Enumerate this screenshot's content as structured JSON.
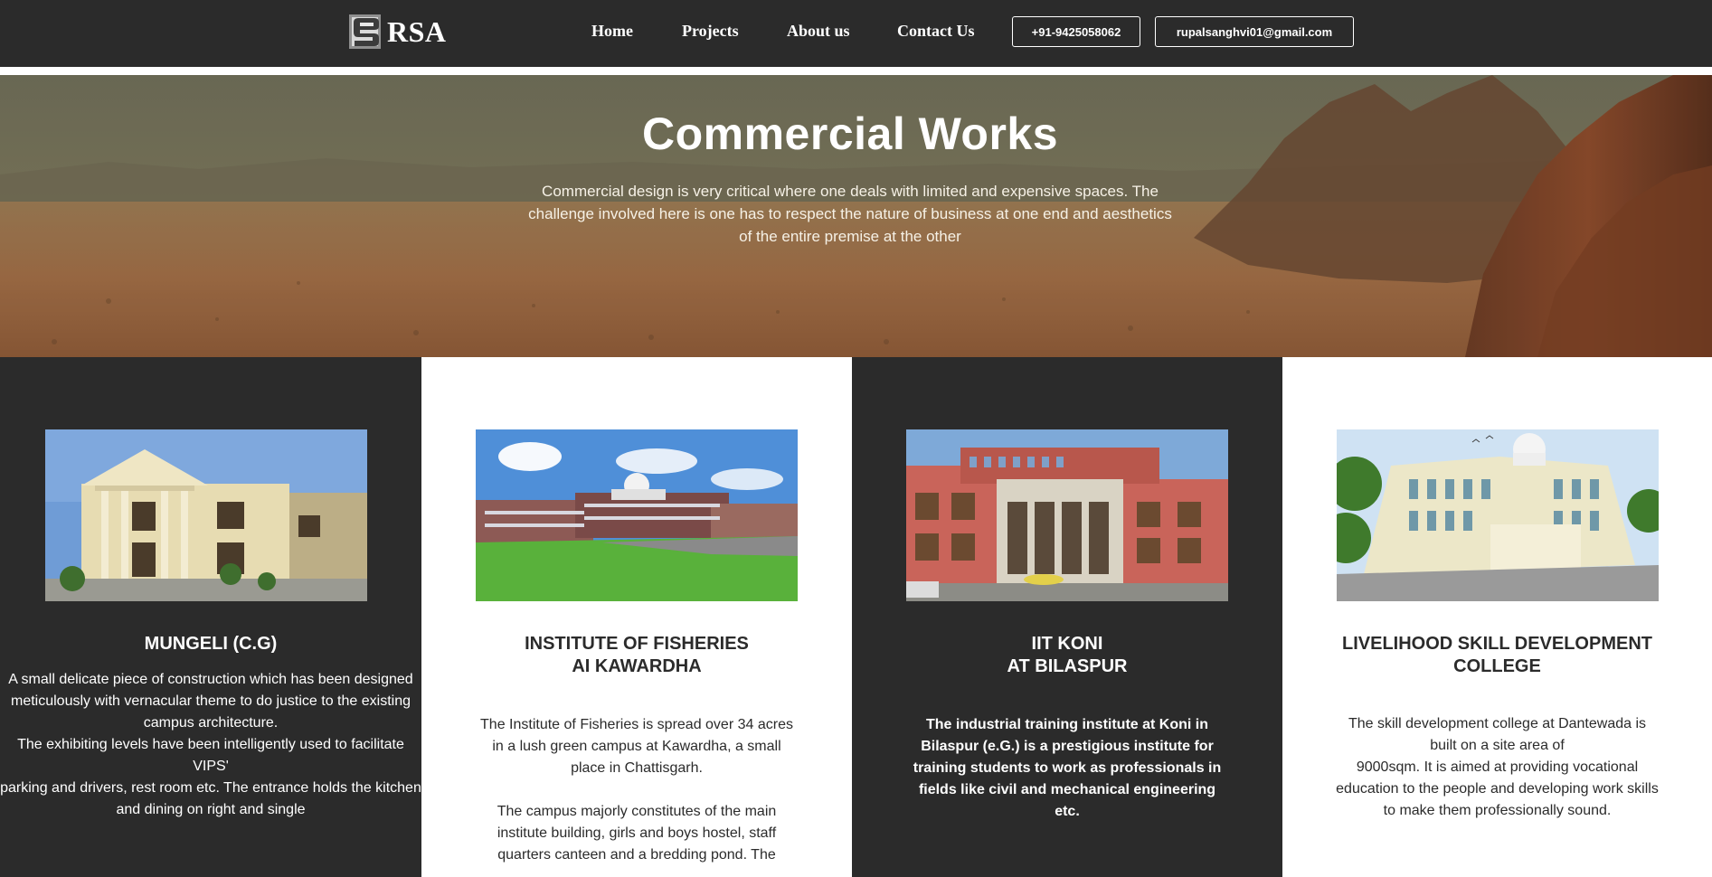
{
  "header": {
    "brand": "RSA",
    "nav": [
      "Home",
      "Projects",
      "About us",
      "Contact Us"
    ],
    "phone": "+91-9425058062",
    "email": "rupalsanghvi01@gmail.com"
  },
  "hero": {
    "title": "Commercial Works",
    "subtitle": "Commercial design is very critical where one deals with limited and expensive spaces. The challenge involved here is one has to respect the nature of business at one end and aesthetics of the entire premise at the other"
  },
  "projects": [
    {
      "title": "MUNGELI (C.G)",
      "description": "A small delicate piece of construction which has been designed meticulously with vernacular theme to do justice to the existing campus architecture.\nThe exhibiting levels have been intelligently used to facilitate VIPS'\nparking and drivers, rest room etc. The entrance holds the kitchen and dining on right and single"
    },
    {
      "title": "INSTITUTE OF FISHERIES\nAI KAWARDHA",
      "description": "The Institute of Fisheries is spread over 34 acres in a lush green campus at Kawardha, a small place in Chattisgarh.\n\nThe campus majorly constitutes of the main institute building, girls and boys hostel, staff quarters canteen and a bredding pond. The"
    },
    {
      "title": "IIT KONI\nAT BILASPUR",
      "description": "The industrial training institute at Koni in Bilaspur (e.G.) is a prestigious institute for training students to work as professionals in fields like civil and mechanical engineering etc."
    },
    {
      "title": "LIVELIHOOD SKILL DEVELOPMENT COLLEGE",
      "description": "The skill development college at Dantewada is built on a site area of\n9000sqm. It is aimed at providing vocational education to the people and developing work skills to make them professionally sound."
    }
  ],
  "colors": {
    "header_bg": "#2b2b2b",
    "dark_card_bg": "#2b2b2b",
    "light_card_bg": "#ffffff",
    "text_light": "#ffffff",
    "text_dark": "#2b2b2b"
  }
}
